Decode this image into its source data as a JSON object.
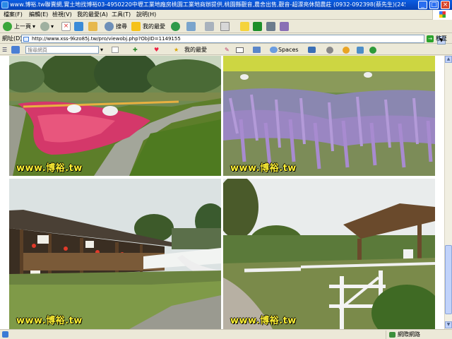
{
  "window": {
    "title": "www.博裕.tw聯賣網,實土地找博裕03-4950220中壢工業地廠房桃園工業地商辦提供,桃園縣觀音,農舍出售,觀音-超漂亮休閒農莊 (0932-092398(蔡先生)(2451坪)3030 - Microsoft Internet E..."
  },
  "menu": [
    "檔案(F)",
    "編輯(E)",
    "檢視(V)",
    "我的最愛(A)",
    "工具(T)",
    "說明(H)"
  ],
  "toolbar": {
    "back_label": "上一頁",
    "search_label": "搜尋",
    "favorites_label": "我的最愛"
  },
  "address": {
    "label": "網址(D)",
    "url": "http://www.xss-9kzo85j.tw/pro/viewobj.php?ObjID=1149155",
    "go_label": "移至"
  },
  "google_bar": {
    "search_placeholder": "搜尋網頁",
    "favorites_label": "我的最愛",
    "spaces_label": "Spaces"
  },
  "photos": {
    "watermark": "www.博裕.tw"
  },
  "status": {
    "zone": "網際網路"
  }
}
